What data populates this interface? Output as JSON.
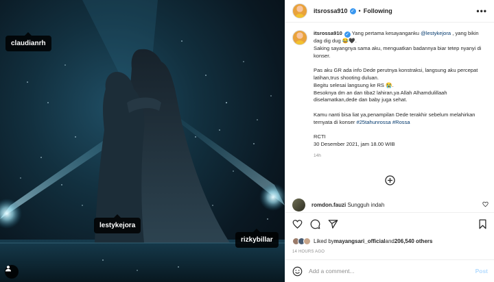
{
  "photo": {
    "tags": [
      "claudianrh",
      "lestykejora",
      "rizkybillar"
    ]
  },
  "header": {
    "username": "itsrossa910",
    "verified_mark": "✓",
    "separator": "•",
    "follow_status": "Following",
    "more": "•••"
  },
  "caption": {
    "username": "itsrossa910",
    "line1_pre": " Yang pertama kesayanganku ",
    "mention": "@lestykejora",
    "line1_post": " , yang bikin dag dig dug 😂🖤.",
    "line2": "Saking sayangnya sama aku, menguatkan badannya biar tetep nyanyi di konser.",
    "line3": "Pas aku GR ada info Dede perutnya konstraksi, langsung aku percepat latihan,trus shooting duluan.",
    "line4": "Begitu selesai langsung ke RS 😭.",
    "line5": "Besoknya dm an dan tiba2 lahiran,ya Allah Alhamdulillaah diselamatkan,dede dan baby juga sehat.",
    "line6_pre": "Kamu nanti bisa liat ya,penampilan Dede terakhir sebelum melahirkan ternyata di konser ",
    "hashtag1": "#25tahunrossa",
    "hashtag2": "#Rossa",
    "line7": "RCTI",
    "line8": "30 Desember 2021, jam 18.00 WIB",
    "time": "14h"
  },
  "comment": {
    "username": "romdon.fauzi",
    "text": "Sungguh indah"
  },
  "likes": {
    "prefix": "Liked by ",
    "user": "mayangsari_official",
    "middle": " and ",
    "count": "206,540 others"
  },
  "time_ago": "14 HOURS AGO",
  "add_comment": {
    "placeholder": "Add a comment...",
    "post_label": "Post"
  },
  "colors": {
    "link": "#00376b",
    "verified": "#3897f0",
    "post_disabled": "#b3dbff"
  }
}
